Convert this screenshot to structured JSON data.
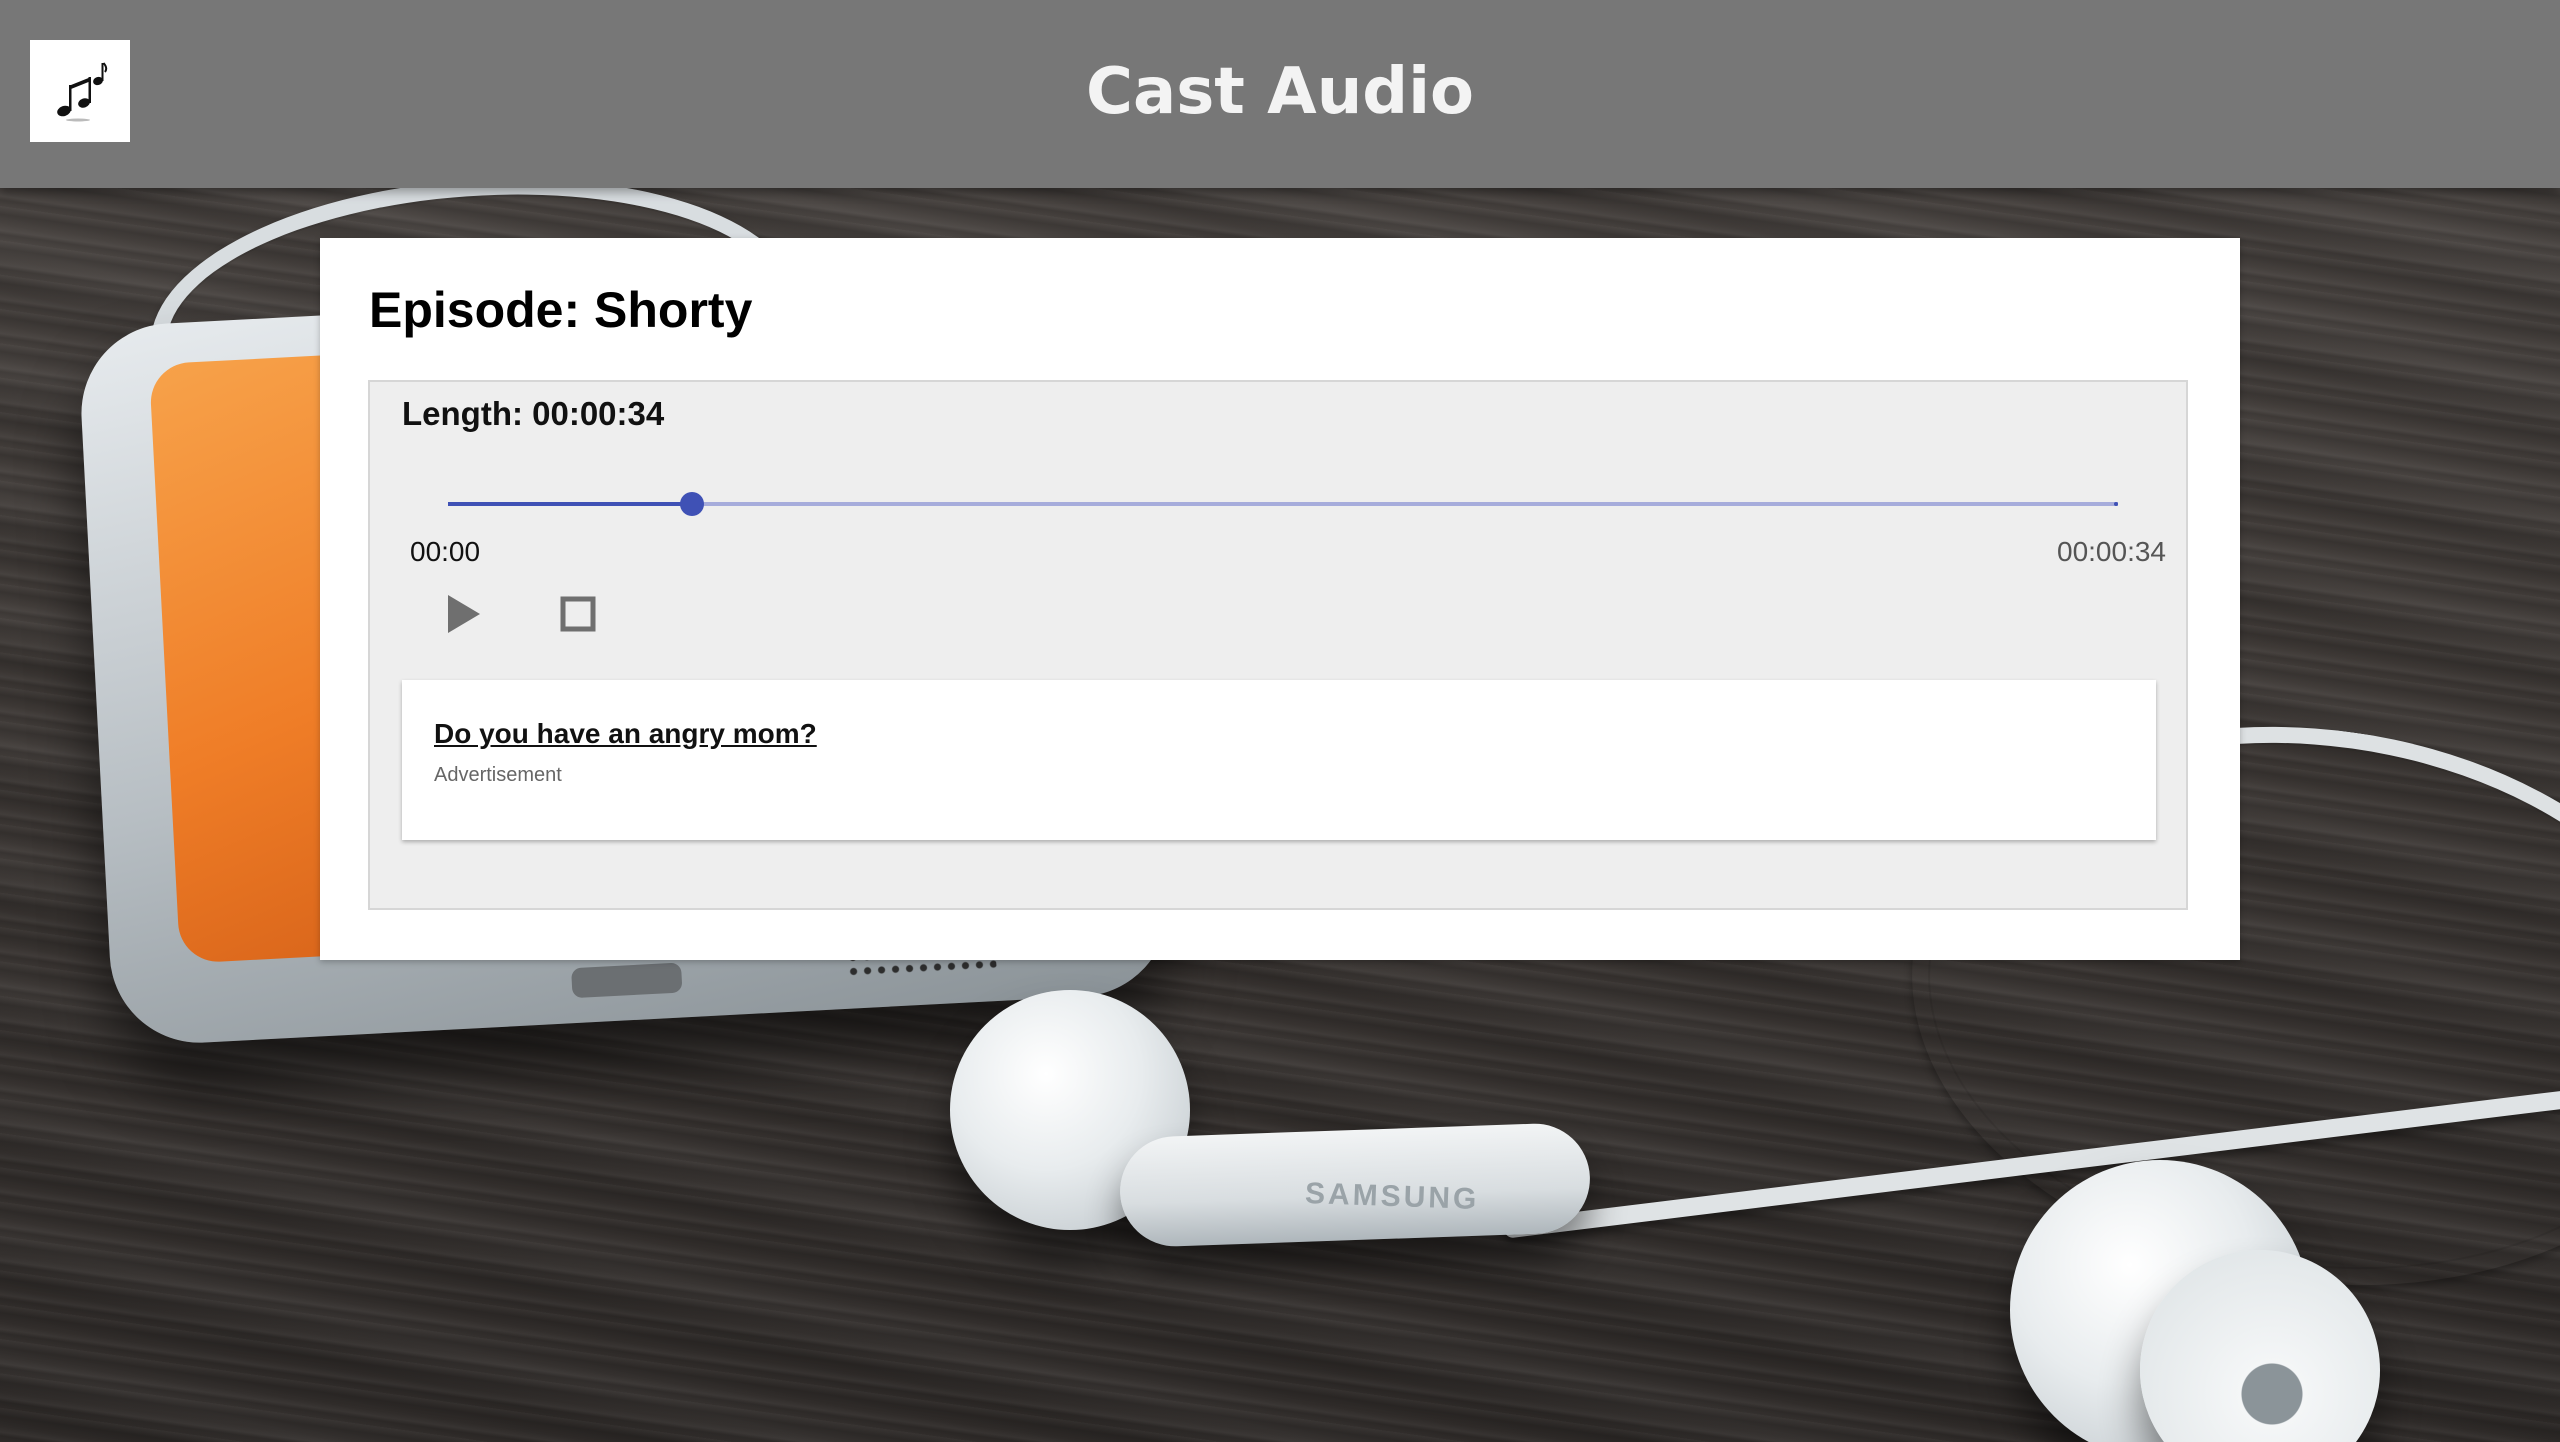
{
  "header": {
    "title": "Cast Audio",
    "logo_icon": "music-notes-icon"
  },
  "episode": {
    "title": "Episode: Shorty",
    "length_label": "Length: 00:00:34"
  },
  "player": {
    "current_time": "00:00",
    "total_time": "00:00:34",
    "progress": 0.146,
    "play_icon": "play-icon",
    "stop_icon": "stop-icon"
  },
  "ad": {
    "link_text": "Do you have an angry mom?",
    "label": "Advertisement"
  },
  "colors": {
    "header_bg": "#777777",
    "accent": "#3f51b5",
    "track": "#a6acdb",
    "player_bg": "#eeeeee"
  },
  "background": {
    "brand_text": "SAMSUNG"
  }
}
